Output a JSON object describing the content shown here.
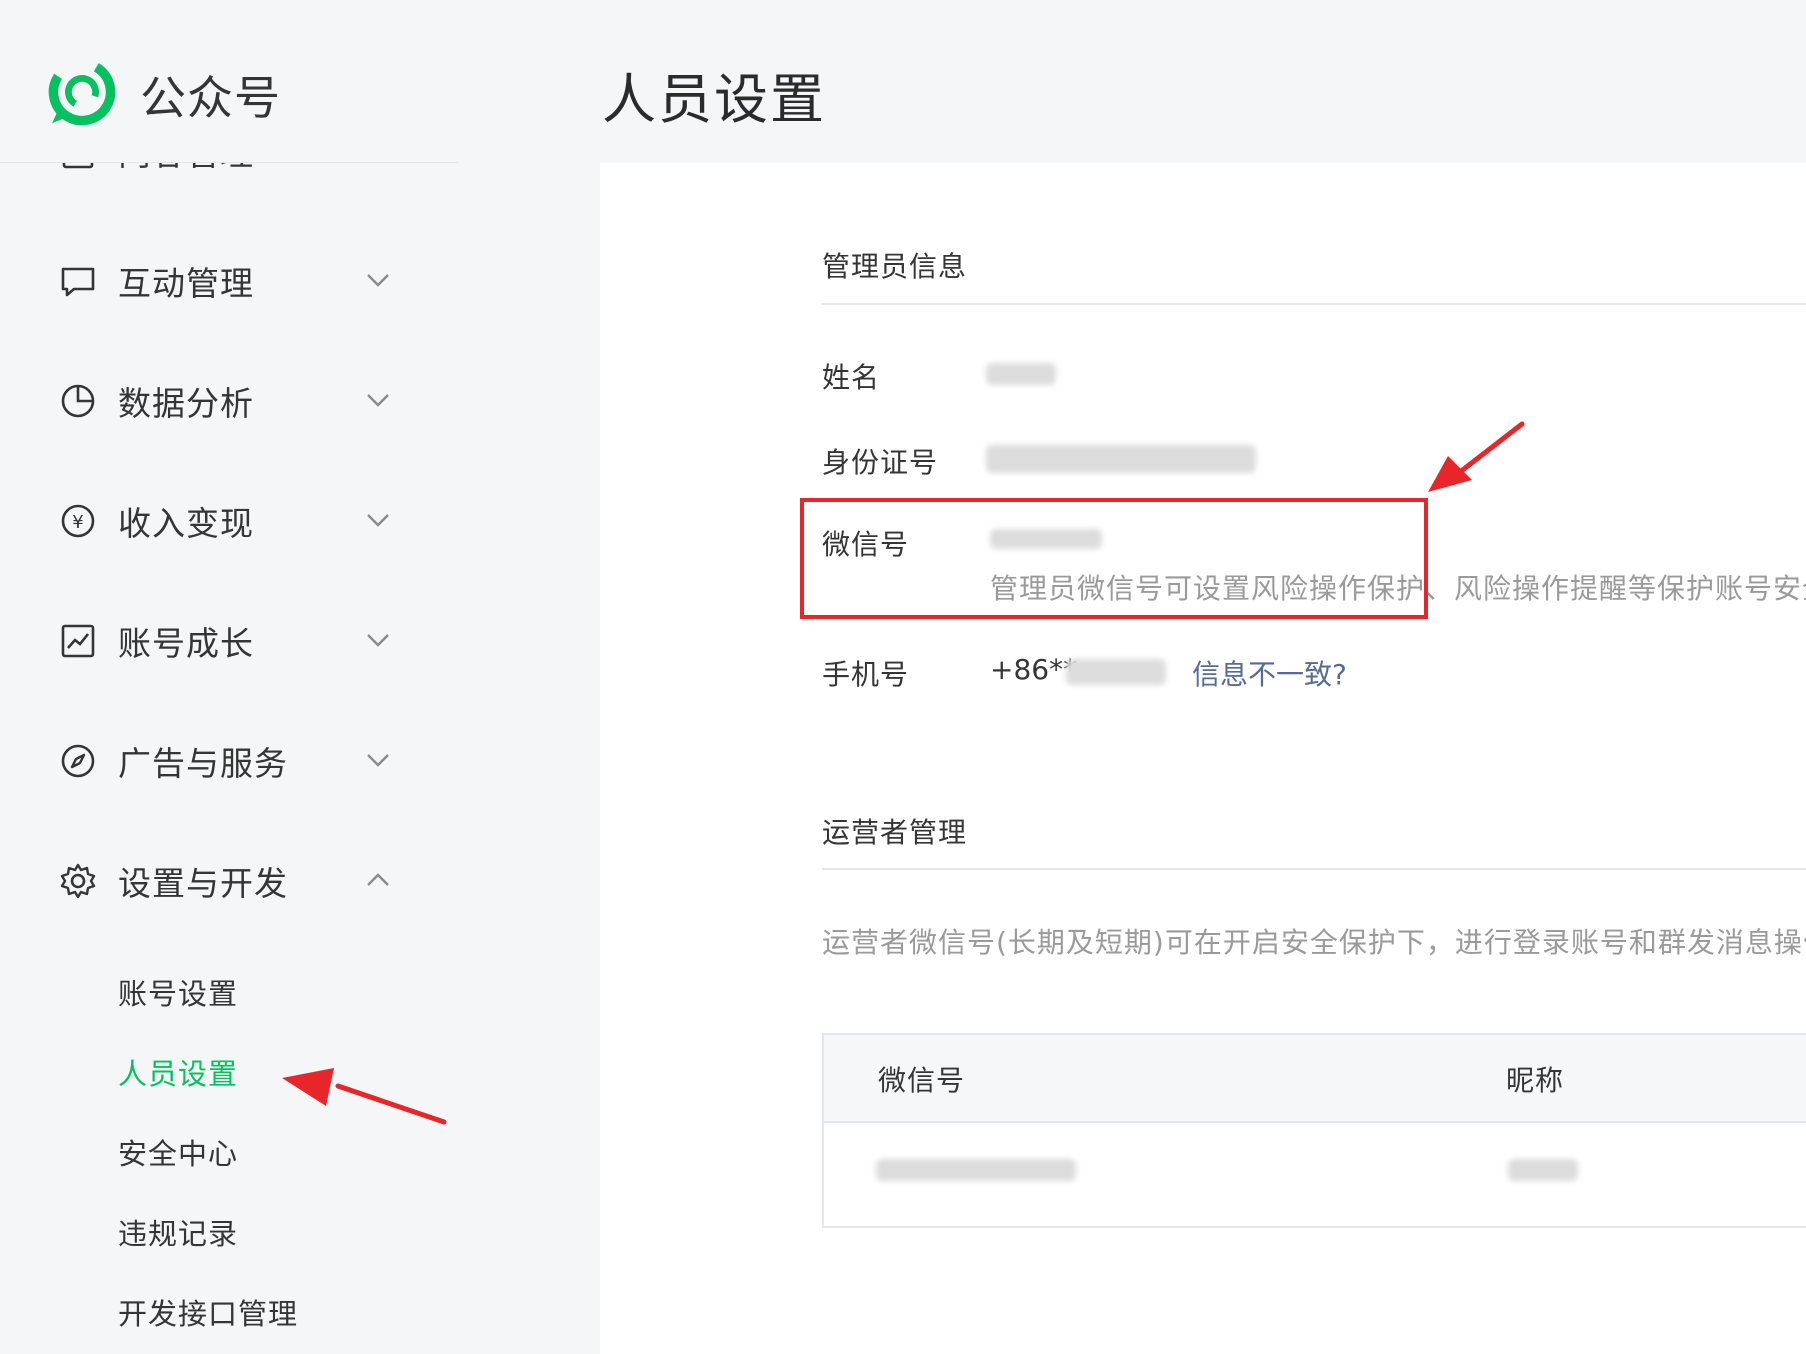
{
  "header": {
    "brand": "公众号",
    "page_title": "人员设置",
    "brand_color": "#07c160"
  },
  "sidebar": {
    "partial_item": {
      "label": "内容管理",
      "icon": "document-icon"
    },
    "items": [
      {
        "label": "互动管理",
        "icon": "chat-bubble-icon",
        "expanded": false
      },
      {
        "label": "数据分析",
        "icon": "pie-chart-icon",
        "expanded": false
      },
      {
        "label": "收入变现",
        "icon": "yen-coin-icon",
        "expanded": false
      },
      {
        "label": "账号成长",
        "icon": "trend-chart-icon",
        "expanded": false
      },
      {
        "label": "广告与服务",
        "icon": "compass-icon",
        "expanded": false
      },
      {
        "label": "设置与开发",
        "icon": "gear-icon",
        "expanded": true
      }
    ],
    "sub_items": [
      {
        "label": "账号设置",
        "active": false
      },
      {
        "label": "人员设置",
        "active": true
      },
      {
        "label": "安全中心",
        "active": false
      },
      {
        "label": "违规记录",
        "active": false
      },
      {
        "label": "开发接口管理",
        "active": false
      }
    ]
  },
  "admin_info": {
    "title": "管理员信息",
    "name_label": "姓名",
    "id_label": "身份证号",
    "wechat_label": "微信号",
    "wechat_hint": "管理员微信号可设置风险操作保护、风险操作提醒等保护账号安全",
    "phone_label": "手机号",
    "phone_value": "+86**",
    "mismatch_link": "信息不一致?"
  },
  "operator": {
    "title": "运营者管理",
    "description": "运营者微信号(长期及短期)可在开启安全保护下，进行登录账号和群发消息操作",
    "columns": [
      "微信号",
      "昵称"
    ]
  },
  "colors": {
    "annotation_red": "#e8262a",
    "link_blue": "#576b95",
    "active_green": "#07c160"
  }
}
